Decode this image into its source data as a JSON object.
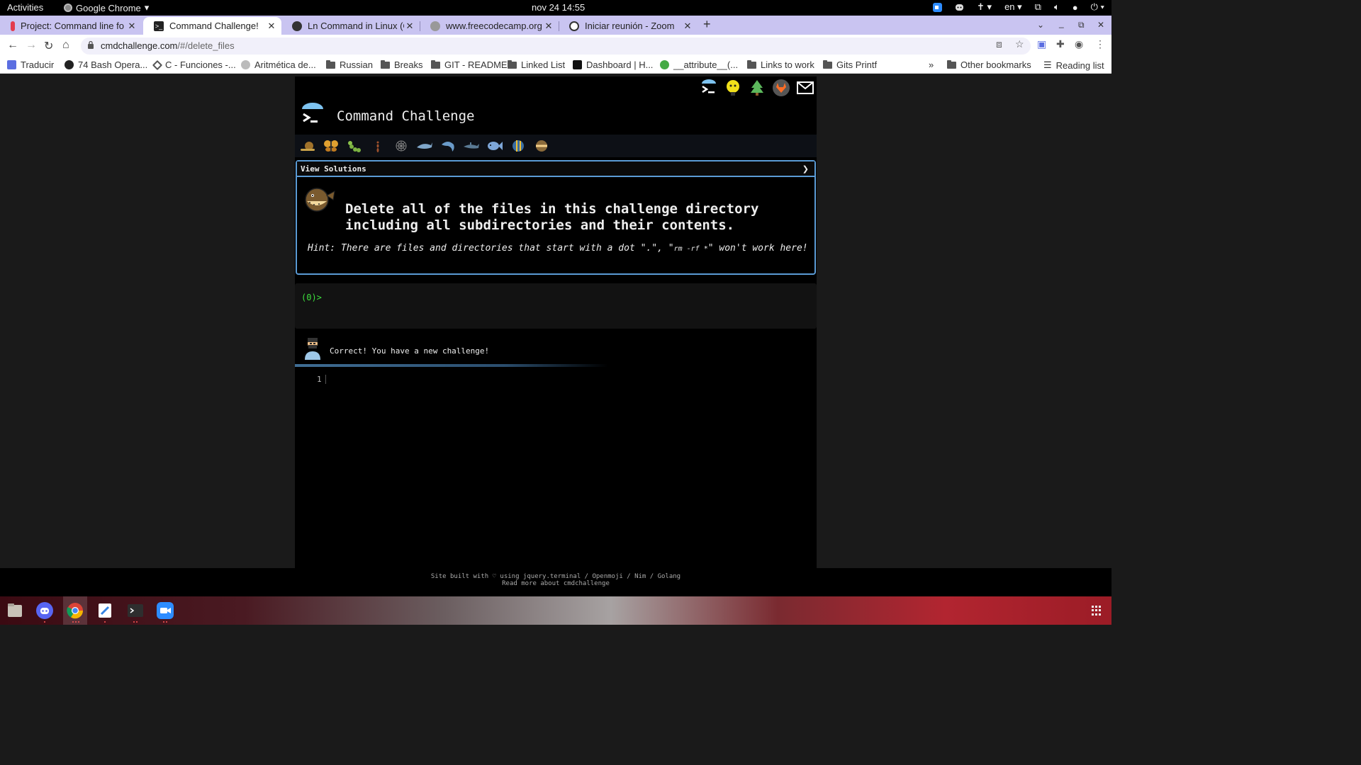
{
  "system": {
    "activities": "Activities",
    "app_name": "Google Chrome",
    "clock": "nov 24  14:55",
    "language": "en"
  },
  "tabs": [
    {
      "title": "Project: Command line fo",
      "fav_color": "#e33b4e",
      "active": false
    },
    {
      "title": "Command Challenge!",
      "fav_color": "#222222",
      "active": true
    },
    {
      "title": "Ln Command in Linux (Cr",
      "fav_color": "#333333",
      "active": false
    },
    {
      "title": "www.freecodecamp.org",
      "fav_color": "#999999",
      "active": false
    },
    {
      "title": "Iniciar reunión - Zoom",
      "fav_color": "#333333",
      "active": false
    }
  ],
  "omnibox": {
    "host": "cmdchallenge.com",
    "path": "/#/delete_files"
  },
  "bookmarks": [
    {
      "label": "Traducir",
      "kind": "translate"
    },
    {
      "label": "74 Bash Opera...",
      "kind": "site"
    },
    {
      "label": "C - Funciones -...",
      "kind": "site"
    },
    {
      "label": "Aritmética de...",
      "kind": "site"
    },
    {
      "label": "Russian",
      "kind": "folder"
    },
    {
      "label": "Breaks",
      "kind": "folder"
    },
    {
      "label": "GIT - README",
      "kind": "folder"
    },
    {
      "label": "Linked List",
      "kind": "folder"
    },
    {
      "label": "Dashboard | H...",
      "kind": "site"
    },
    {
      "label": "__attribute__(...",
      "kind": "site"
    },
    {
      "label": "Links to work",
      "kind": "folder"
    },
    {
      "label": "Gits Printf",
      "kind": "folder"
    }
  ],
  "bookmarks_overflow": "»",
  "other_bookmarks": "Other bookmarks",
  "reading_list": "Reading list",
  "page": {
    "title": "Command Challenge",
    "header_icons": [
      "terminal-icon",
      "lightbulb-icon",
      "tree-icon",
      "gitlab-icon",
      "mail-icon"
    ],
    "level_icons": [
      "snail-icon",
      "butterfly-icon",
      "caterpillar-icon",
      "ant-icon",
      "spiderweb-icon",
      "shark-icon",
      "dolphin-icon",
      "hammerhead-icon",
      "fish-icon",
      "tropical-fish-icon",
      "pufferfish-icon"
    ],
    "view_solutions": "View Solutions",
    "view_solutions_arrow": "❯",
    "challenge_prompt": "Delete all of the files in this challenge directory including all subdirectories and their contents.",
    "hint_prefix": "Hint: There are files and directories that start with a dot \".\", \"",
    "hint_code": "rm -rf *",
    "hint_suffix": "\" won't work here!",
    "terminal_prompt": "(0)>",
    "feedback": "Correct! You have a new challenge!",
    "editor_line": "1",
    "footer_line1": "Site built with ♡ using jquery.terminal / Openmoji / Nim / Golang",
    "footer_line2": "Read more about cmdchallenge"
  },
  "dock": [
    "files-icon",
    "discord-icon",
    "chrome-icon",
    "text-editor-icon",
    "terminal-icon",
    "zoom-icon"
  ],
  "colors": {
    "accent_border": "#5b9bd5",
    "prompt_green": "#3de03d",
    "tab_strip": "#c9c4f1"
  }
}
